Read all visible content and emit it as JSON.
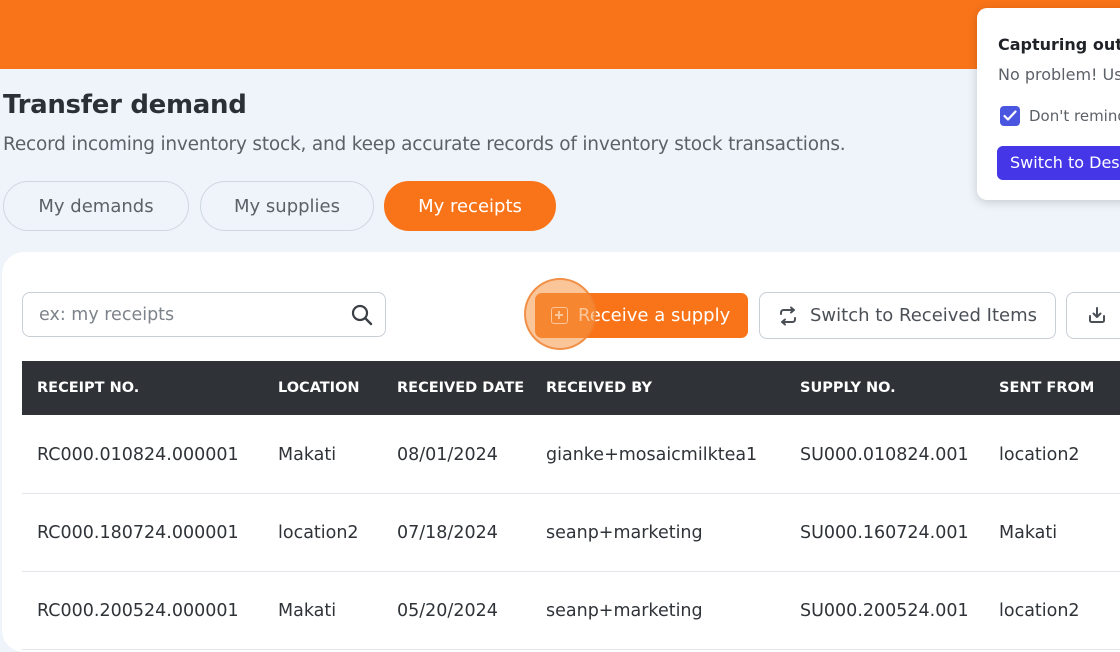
{
  "header": {
    "title": "Transfer demand",
    "description": "Record incoming inventory stock, and keep accurate records of inventory stock transactions."
  },
  "tabs": [
    {
      "label": "My demands",
      "active": false
    },
    {
      "label": "My supplies",
      "active": false
    },
    {
      "label": "My receipts",
      "active": true
    }
  ],
  "search": {
    "placeholder": "ex: my receipts",
    "value": ""
  },
  "toolbar": {
    "receive_label": "Receive a supply",
    "switch_label": "Switch to Received Items"
  },
  "table": {
    "columns": [
      "RECEIPT NO.",
      "LOCATION",
      "RECEIVED DATE",
      "RECEIVED BY",
      "SUPPLY NO.",
      "SENT FROM"
    ],
    "rows": [
      [
        "RC000.010824.000001",
        "Makati",
        "08/01/2024",
        "gianke+mosaicmilktea1",
        "SU000.010824.001",
        "location2"
      ],
      [
        "RC000.180724.000001",
        "location2",
        "07/18/2024",
        "seanp+marketing",
        "SU000.160724.001",
        "Makati"
      ],
      [
        "RC000.200524.000001",
        "Makati",
        "05/20/2024",
        "seanp+marketing",
        "SU000.200524.001",
        "location2"
      ]
    ]
  },
  "popup": {
    "title": "Capturing outs",
    "body": "No problem! Us",
    "checkbox_label": "Don't remind",
    "checkbox_checked": true,
    "button_label": "Switch to Des"
  },
  "colors": {
    "accent": "#f97419",
    "table_header": "#2f3236",
    "popup_button": "#4536e8"
  }
}
